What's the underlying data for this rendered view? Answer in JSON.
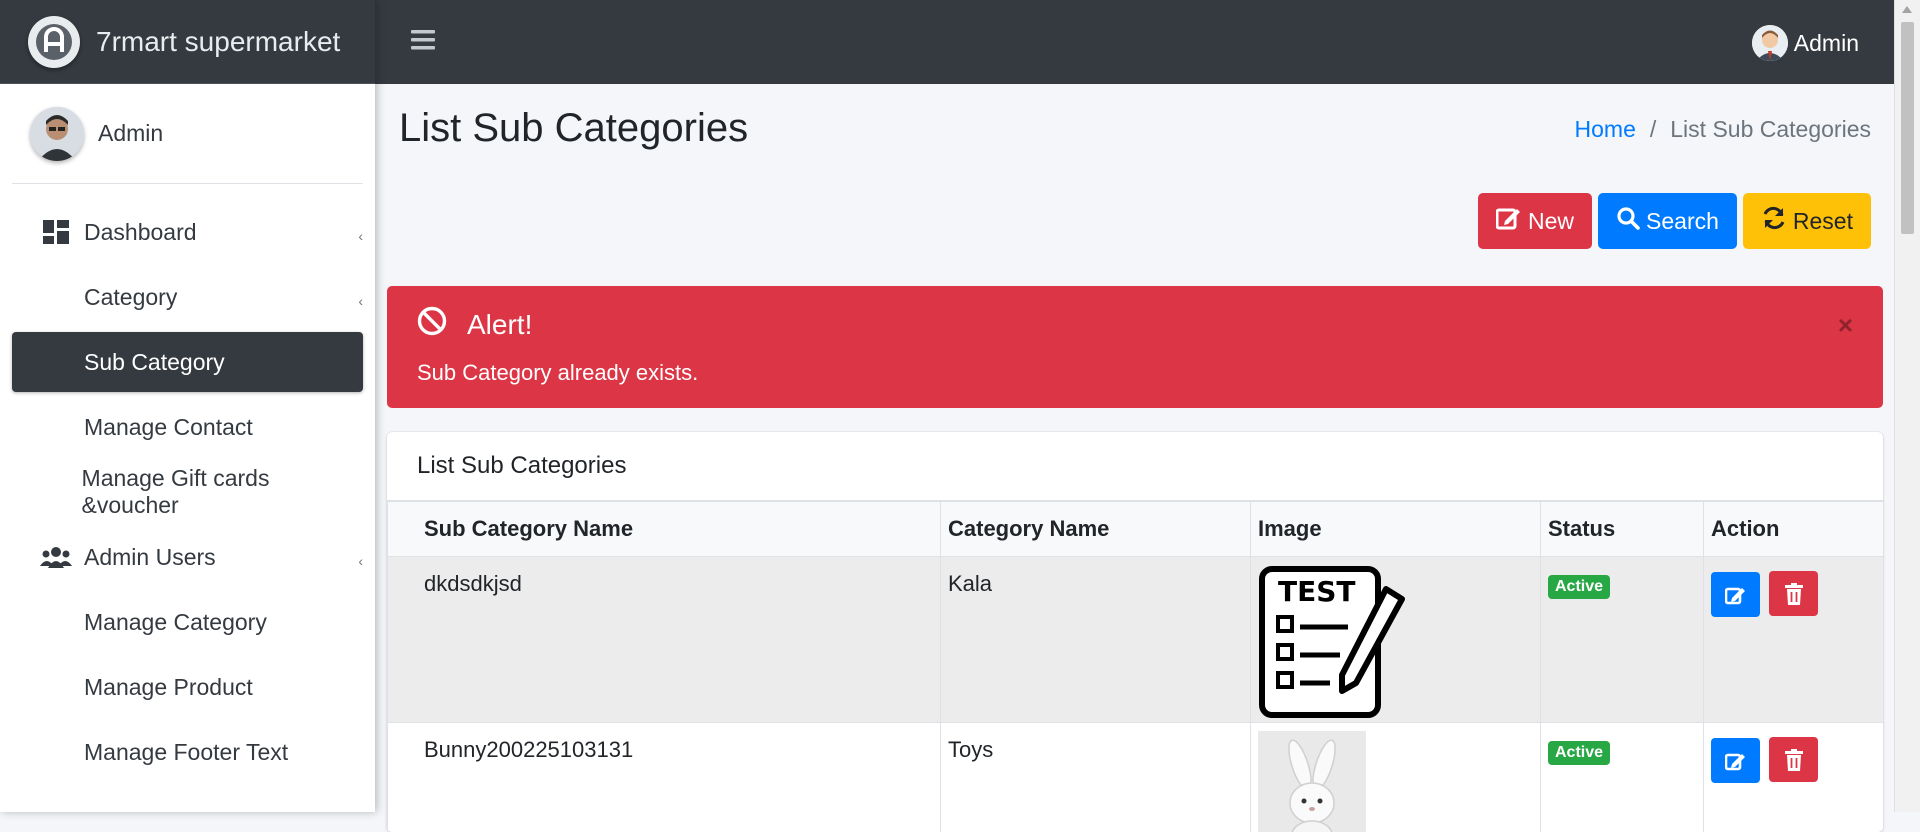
{
  "app": {
    "brand": "7rmart supermarket"
  },
  "sidebar": {
    "user_name": "Admin",
    "items": [
      {
        "label": "Dashboard",
        "icon": "dashboard-icon",
        "has_caret": true
      },
      {
        "label": "Category",
        "icon": "",
        "has_caret": true
      },
      {
        "label": "Sub Category",
        "icon": "",
        "active": true
      },
      {
        "label": "Manage Contact",
        "icon": ""
      },
      {
        "label": "Manage Gift cards &voucher",
        "icon": ""
      },
      {
        "label": "Admin Users",
        "icon": "users-icon",
        "has_caret": true
      },
      {
        "label": "Manage Category",
        "icon": ""
      },
      {
        "label": "Manage Product",
        "icon": ""
      },
      {
        "label": "Manage Footer Text",
        "icon": ""
      }
    ]
  },
  "topbar": {
    "user_name": "Admin"
  },
  "page": {
    "title": "List Sub Categories",
    "breadcrumb": {
      "home": "Home",
      "separator": "/",
      "current": "List Sub Categories"
    }
  },
  "toolbar": {
    "new_label": "New",
    "search_label": "Search",
    "reset_label": "Reset"
  },
  "alert": {
    "title": "Alert!",
    "message": "Sub Category already exists.",
    "close": "×"
  },
  "card": {
    "title": "List Sub Categories",
    "columns": [
      "Sub Category Name",
      "Category Name",
      "Image",
      "Status",
      "Action"
    ],
    "rows": [
      {
        "sub_category": "dkdsdkjsd",
        "category": "Kala",
        "image": "test-checklist-image",
        "status": "Active"
      },
      {
        "sub_category": "Bunny200225103131",
        "category": "Toys",
        "image": "bunny-plush-image",
        "status": "Active"
      }
    ]
  },
  "colors": {
    "dark": "#343a40",
    "primary": "#007bff",
    "danger": "#dc3545",
    "warning": "#ffc107",
    "success": "#28a745"
  }
}
